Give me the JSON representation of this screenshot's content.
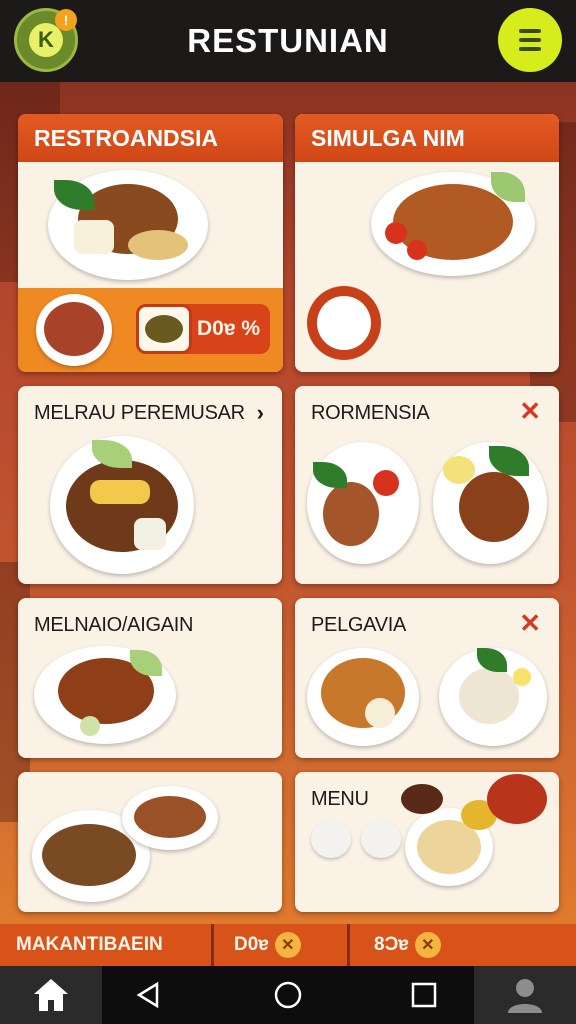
{
  "header": {
    "logo_letter": "K",
    "notification_badge": "!",
    "title": "RESTUNIAN"
  },
  "cards": [
    {
      "title": "RESTROANDSIA",
      "price": "D0ɐ %"
    },
    {
      "title": "SIMULGA NIM"
    },
    {
      "title": "MELRAU PEREMUSAR"
    },
    {
      "title": "RORMENSIA"
    },
    {
      "title": "MELNAIO/AIGAIN"
    },
    {
      "title": "PELGAVIA"
    },
    {
      "title": ""
    },
    {
      "title": "MENU"
    }
  ],
  "strip": [
    {
      "label": "MAKANTIBAEIN"
    },
    {
      "label": "D0ɐ"
    },
    {
      "label": "8Ɔɐ"
    }
  ],
  "colors": {
    "accent": "#e45a22",
    "menu_button": "#d7ec1c",
    "logo": "#6b8a2a"
  },
  "icons": {
    "menu": "hamburger-icon",
    "home": "home-icon",
    "back": "back-triangle-icon",
    "circle": "home-circle-icon",
    "recent": "recent-square-icon",
    "profile": "profile-icon",
    "favorite": "x-mark-icon"
  }
}
